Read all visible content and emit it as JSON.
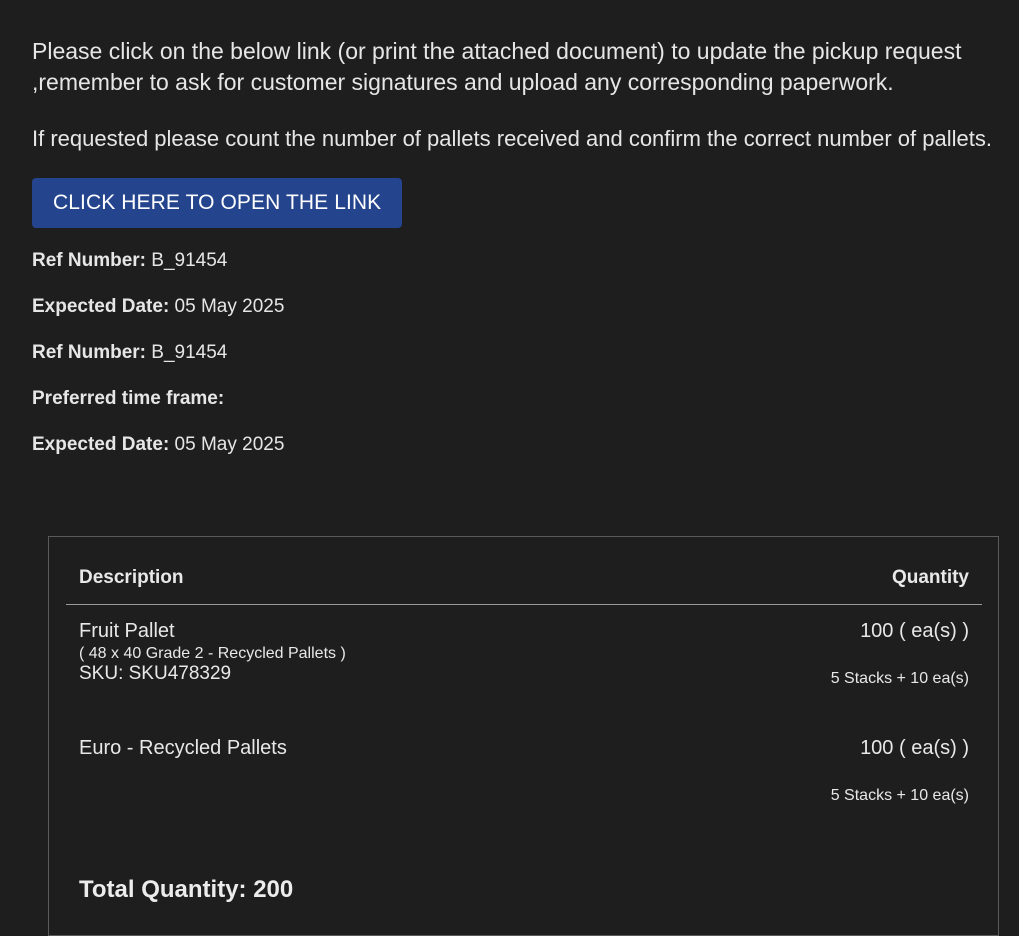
{
  "intro": {
    "paragraph1": "Please click on the below link (or print the attached document) to update the pickup request ,remember to ask for customer signatures and upload any corresponding paperwork.",
    "paragraph2": "If requested please count the number of pallets received and confirm the correct number of pallets."
  },
  "cta": {
    "label": "CLICK HERE TO OPEN THE LINK",
    "color": "#24458d"
  },
  "meta": [
    {
      "key": "Ref Number:",
      "value": " B_91454"
    },
    {
      "key": "Expected Date:",
      "value": " 05 May 2025"
    },
    {
      "key": "Ref Number:",
      "value": " B_91454"
    },
    {
      "key": "Preferred time frame:",
      "value": ""
    },
    {
      "key": "Expected Date:",
      "value": " 05 May 2025"
    }
  ],
  "table": {
    "headers": {
      "description": "Description",
      "quantity": "Quantity"
    },
    "items": [
      {
        "name": "Fruit Pallet",
        "sub": "( 48 x 40 Grade 2 - Recycled Pallets )",
        "sku": "SKU: SKU478329",
        "qty": "100 ( ea(s) )",
        "stacks": "5 Stacks + 10 ea(s)"
      },
      {
        "name": "Euro - Recycled Pallets",
        "sub": "",
        "sku": "",
        "qty": "100 ( ea(s) )",
        "stacks": "5 Stacks + 10 ea(s)"
      }
    ],
    "total": "Total Quantity: 200"
  },
  "colors": {
    "background": "#1e1e1e",
    "text": "#e8e8e8",
    "button": "#24458d"
  }
}
